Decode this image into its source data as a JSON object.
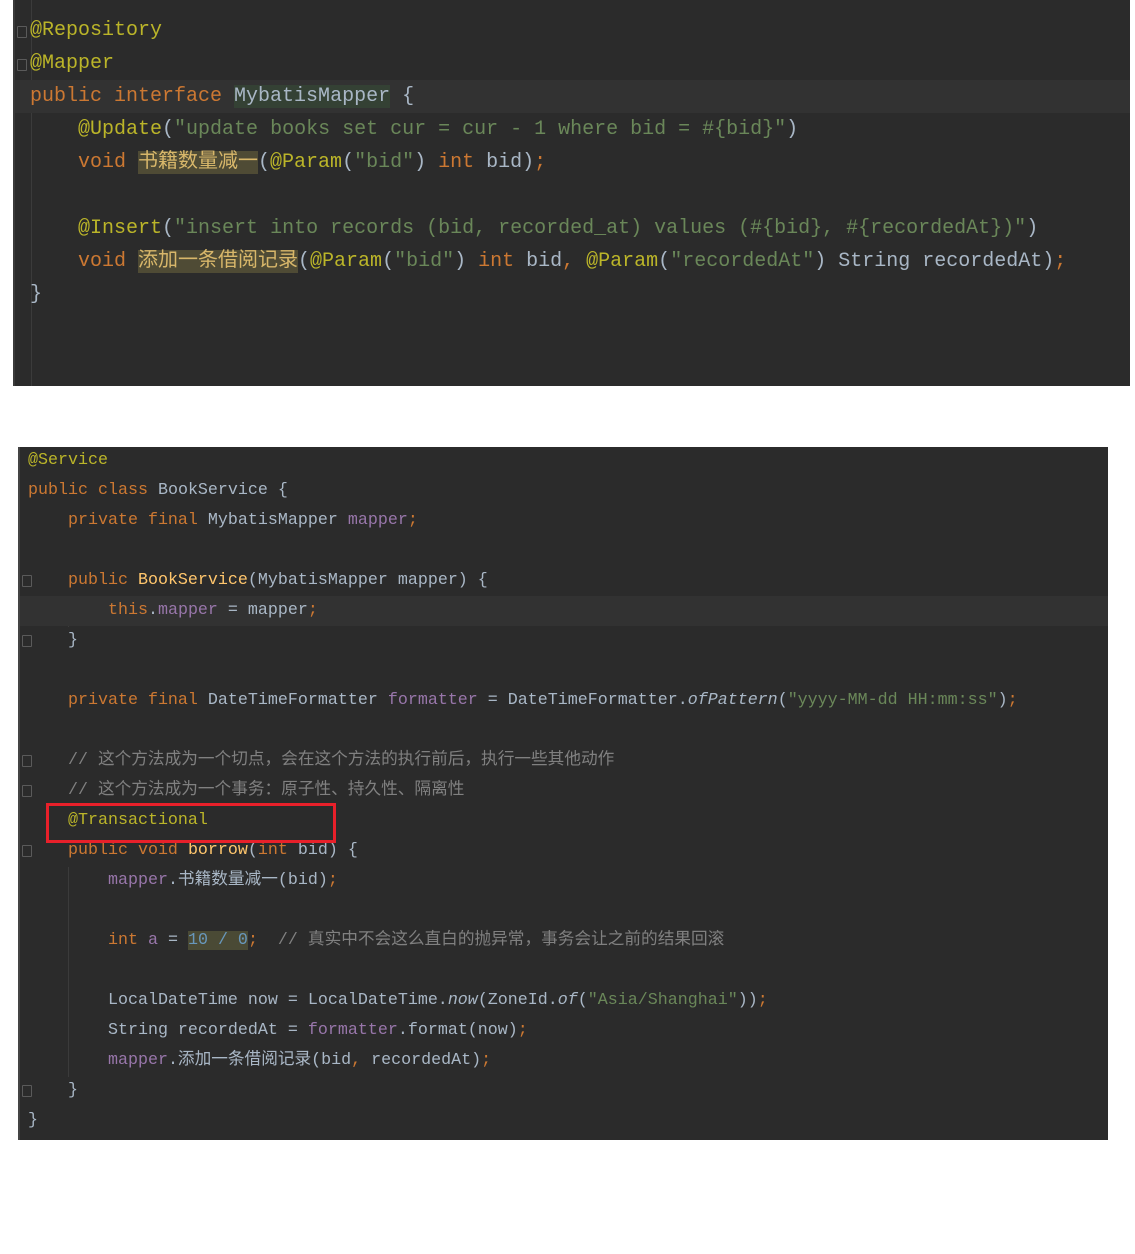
{
  "mapper_file": {
    "current_line": 2,
    "lines": [
      [
        [
          "a",
          "@Repository"
        ]
      ],
      [
        [
          "a",
          "@Mapper"
        ]
      ],
      [
        [
          "k",
          "public interface "
        ],
        [
          "hc",
          "MybatisMapper"
        ],
        [
          "d",
          " {"
        ]
      ],
      [
        [
          "d",
          "    "
        ],
        [
          "a",
          "@Update"
        ],
        [
          "d",
          "("
        ],
        [
          "s",
          "\"update books set cur = cur - 1 where bid = #{bid}\""
        ],
        [
          "d",
          ")"
        ]
      ],
      [
        [
          "k",
          "    void "
        ],
        [
          "hm",
          "书籍数量减一"
        ],
        [
          "d",
          "("
        ],
        [
          "a",
          "@Param"
        ],
        [
          "d",
          "("
        ],
        [
          "s",
          "\"bid\""
        ],
        [
          "d",
          ") "
        ],
        [
          "k",
          "int "
        ],
        [
          "d",
          "bid)"
        ],
        [
          "k",
          ";"
        ]
      ],
      [],
      [
        [
          "d",
          "    "
        ],
        [
          "a",
          "@Insert"
        ],
        [
          "d",
          "("
        ],
        [
          "s",
          "\"insert into records (bid, recorded_at) values (#{bid}, #{recordedAt})\""
        ],
        [
          "d",
          ")"
        ]
      ],
      [
        [
          "k",
          "    void "
        ],
        [
          "hm",
          "添加一条借阅记录"
        ],
        [
          "d",
          "("
        ],
        [
          "a",
          "@Param"
        ],
        [
          "d",
          "("
        ],
        [
          "s",
          "\"bid\""
        ],
        [
          "d",
          ") "
        ],
        [
          "k",
          "int "
        ],
        [
          "d",
          "bid"
        ],
        [
          "k",
          ", "
        ],
        [
          "a",
          "@Param"
        ],
        [
          "d",
          "("
        ],
        [
          "s",
          "\"recordedAt\""
        ],
        [
          "d",
          ") String recordedAt)"
        ],
        [
          "k",
          ";"
        ]
      ],
      [
        [
          "d",
          "}"
        ]
      ]
    ]
  },
  "service_file": {
    "current_line": 5,
    "highlight_box_line": 12,
    "highlight_color": "#e8202a",
    "lines": [
      [
        [
          "a",
          "@Service"
        ]
      ],
      [
        [
          "k",
          "public class "
        ],
        [
          "d",
          "BookService {"
        ]
      ],
      [
        [
          "k",
          "    private final "
        ],
        [
          "d",
          "MybatisMapper "
        ],
        [
          "f",
          "mapper"
        ],
        [
          "k",
          ";"
        ]
      ],
      [],
      [
        [
          "k",
          "    public "
        ],
        [
          "m",
          "BookService"
        ],
        [
          "d",
          "(MybatisMapper mapper) {"
        ]
      ],
      [
        [
          "k",
          "        this"
        ],
        [
          "d",
          "."
        ],
        [
          "f",
          "mapper"
        ],
        [
          "d",
          " = mapper"
        ],
        [
          "k",
          ";"
        ]
      ],
      [
        [
          "d",
          "    }"
        ]
      ],
      [],
      [
        [
          "k",
          "    private final "
        ],
        [
          "d",
          "DateTimeFormatter "
        ],
        [
          "f",
          "formatter"
        ],
        [
          "d",
          " = DateTimeFormatter."
        ],
        [
          "i",
          "ofPattern"
        ],
        [
          "d",
          "("
        ],
        [
          "s",
          "\"yyyy-MM-dd HH:mm:ss\""
        ],
        [
          "d",
          ")"
        ],
        [
          "k",
          ";"
        ]
      ],
      [],
      [
        [
          "c",
          "    // 这个方法成为一个切点，会在这个方法的执行前后，执行一些其他动作"
        ]
      ],
      [
        [
          "c",
          "    // 这个方法成为一个事务：原子性、持久性、隔离性"
        ]
      ],
      [
        [
          "a",
          "    @Transactional"
        ]
      ],
      [
        [
          "k",
          "    public void "
        ],
        [
          "m",
          "borrow"
        ],
        [
          "d",
          "("
        ],
        [
          "k",
          "int "
        ],
        [
          "d",
          "bid) {"
        ]
      ],
      [
        [
          "f",
          "        mapper"
        ],
        [
          "d",
          ".书籍数量减一(bid)"
        ],
        [
          "k",
          ";"
        ]
      ],
      [],
      [
        [
          "k",
          "        int "
        ],
        [
          "f",
          "a"
        ],
        [
          "d",
          " = "
        ],
        [
          "hn",
          "10 / 0"
        ],
        [
          "k",
          ";"
        ],
        [
          "c",
          "  // 真实中不会这么直白的抛异常，事务会让之前的结果回滚"
        ]
      ],
      [],
      [
        [
          "d",
          "        LocalDateTime now = LocalDateTime."
        ],
        [
          "i",
          "now"
        ],
        [
          "d",
          "(ZoneId."
        ],
        [
          "i",
          "of"
        ],
        [
          "d",
          "("
        ],
        [
          "s",
          "\"Asia/Shanghai\""
        ],
        [
          "d",
          "))"
        ],
        [
          "k",
          ";"
        ]
      ],
      [
        [
          "d",
          "        String recordedAt = "
        ],
        [
          "f",
          "formatter"
        ],
        [
          "d",
          ".format(now)"
        ],
        [
          "k",
          ";"
        ]
      ],
      [
        [
          "f",
          "        mapper"
        ],
        [
          "d",
          ".添加一条借阅记录(bid"
        ],
        [
          "k",
          ", "
        ],
        [
          "d",
          "recordedAt)"
        ],
        [
          "k",
          ";"
        ]
      ],
      [
        [
          "d",
          "    }"
        ]
      ],
      [
        [
          "d",
          "}"
        ]
      ]
    ]
  }
}
